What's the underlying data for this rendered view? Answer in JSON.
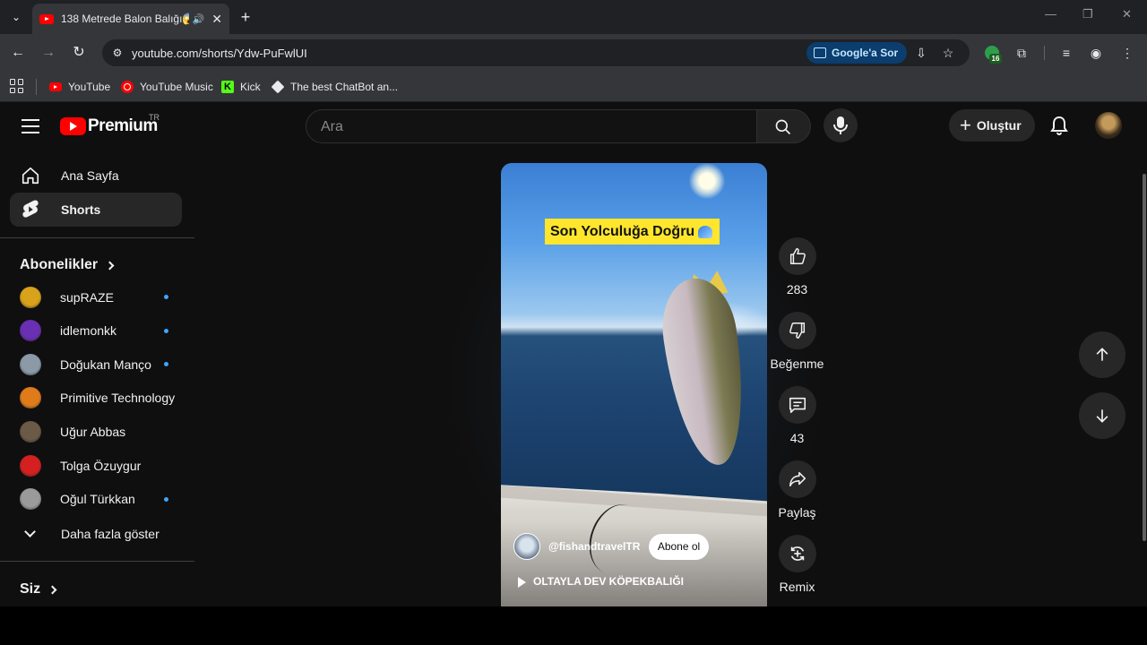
{
  "browser": {
    "tab_title": "138 Metrede Balon Balığı😱",
    "url": "youtube.com/shorts/Ydw-PuFwlUI",
    "ask_google_label": "Google'a Sor",
    "extension_badge": "16",
    "bookmarks": [
      {
        "label": "YouTube",
        "icon": "youtube-icon"
      },
      {
        "label": "YouTube Music",
        "icon": "youtube-music-icon"
      },
      {
        "label": "Kick",
        "icon": "kick-icon"
      },
      {
        "label": "The best ChatBot an...",
        "icon": "chatbot-icon"
      }
    ]
  },
  "youtube": {
    "logo_text": "Premium",
    "country_code": "TR",
    "search_placeholder": "Ara",
    "create_label": "Oluştur",
    "sidebar": {
      "nav": [
        {
          "label": "Ana Sayfa",
          "icon": "home-icon"
        },
        {
          "label": "Shorts",
          "icon": "shorts-icon",
          "active": true
        }
      ],
      "subscriptions_title": "Abonelikler",
      "subscriptions": [
        {
          "name": "supRAZE",
          "new": true,
          "color": "#d8a21a"
        },
        {
          "name": "idlemonkk",
          "new": true,
          "color": "#6a2fb3"
        },
        {
          "name": "Doğukan Manço",
          "new": true,
          "color": "#8c9aa8"
        },
        {
          "name": "Primitive Technology",
          "new": false,
          "color": "#e07b1a"
        },
        {
          "name": "Uğur Abbas",
          "new": false,
          "color": "#6b5a48"
        },
        {
          "name": "Tolga Özuygur",
          "new": false,
          "color": "#d42020"
        },
        {
          "name": "Oğul Türkkan",
          "new": true,
          "color": "#9a9a9a"
        }
      ],
      "show_more_label": "Daha fazla göster",
      "you_title": "Siz"
    },
    "short": {
      "caption": "Son Yolculuğa Doğru",
      "channel_handle": "@fishandtravelTR",
      "subscribe_label": "Abone ol",
      "video_title": "OLTAYLA DEV KÖPEKBALIĞI",
      "likes": "283",
      "dislike_label": "Beğenme",
      "comments": "43",
      "share_label": "Paylaş",
      "remix_label": "Remix"
    }
  },
  "colors": {
    "brand_red": "#ff0000",
    "accent_blue": "#3ea6ff",
    "page_bg": "#0f0f0f"
  }
}
